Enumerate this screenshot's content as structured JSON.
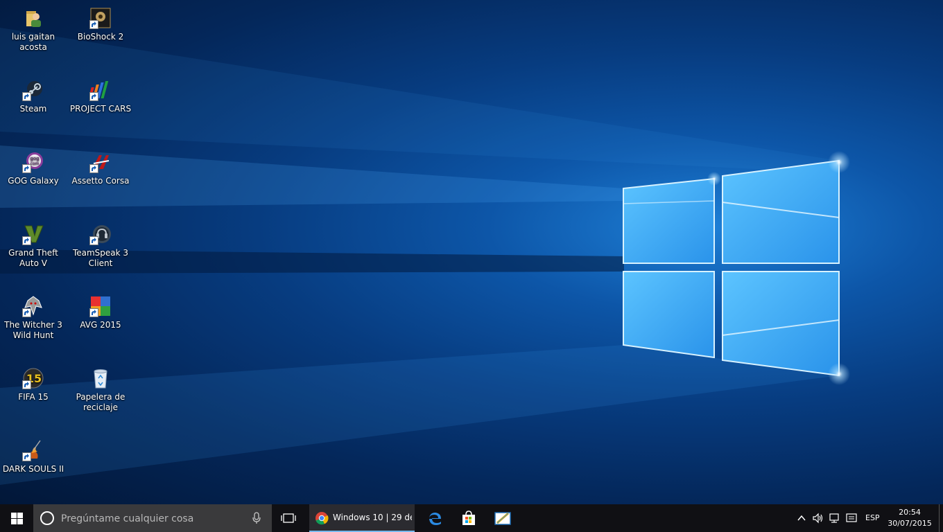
{
  "desktop": {
    "icons": [
      {
        "label": "luis gaitan acosta",
        "icon": "user-folder-icon"
      },
      {
        "label": "BioShock 2",
        "icon": "bioshock-icon"
      },
      {
        "label": "Steam",
        "icon": "steam-icon"
      },
      {
        "label": "PROJECT CARS",
        "icon": "project-cars-icon"
      },
      {
        "label": "GOG Galaxy",
        "icon": "gog-galaxy-icon"
      },
      {
        "label": "Assetto Corsa",
        "icon": "assetto-corsa-icon"
      },
      {
        "label": "Grand Theft Auto V",
        "icon": "gta-v-icon"
      },
      {
        "label": "TeamSpeak 3 Client",
        "icon": "teamspeak-icon"
      },
      {
        "label": "The Witcher 3 Wild Hunt",
        "icon": "witcher-icon"
      },
      {
        "label": "AVG 2015",
        "icon": "avg-icon"
      },
      {
        "label": "FIFA 15",
        "icon": "fifa-icon"
      },
      {
        "label": "Papelera de reciclaje",
        "icon": "recycle-bin-icon"
      },
      {
        "label": "DARK SOULS II",
        "icon": "dark-souls-icon"
      }
    ]
  },
  "taskbar": {
    "search_placeholder": "Pregúntame cualquier cosa",
    "chrome_task_title": "Windows 10 | 29 de...",
    "language": "ESP",
    "time": "20:54",
    "date": "30/07/2015"
  },
  "colors": {
    "taskbar_bg": "#101014",
    "search_bg": "#3a3a3c",
    "active_underline": "#76b9ed"
  }
}
